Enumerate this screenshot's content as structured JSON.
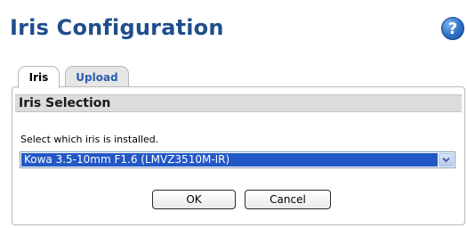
{
  "header": {
    "title": "Iris Configuration",
    "help_icon": "question-mark-icon",
    "help_glyph": "?"
  },
  "tabs": [
    {
      "label": "Iris",
      "active": true
    },
    {
      "label": "Upload",
      "active": false
    }
  ],
  "section": {
    "title": "Iris Selection",
    "instruction": "Select which iris is installed.",
    "iris_select": {
      "selected": "Kowa 3.5-10mm F1.6 (LMVZ3510M-IR)"
    }
  },
  "buttons": {
    "ok_label": "OK",
    "cancel_label": "Cancel"
  },
  "colors": {
    "title": "#1f4e8c",
    "accent": "#2257c6",
    "tab_link": "#2a5db0"
  }
}
